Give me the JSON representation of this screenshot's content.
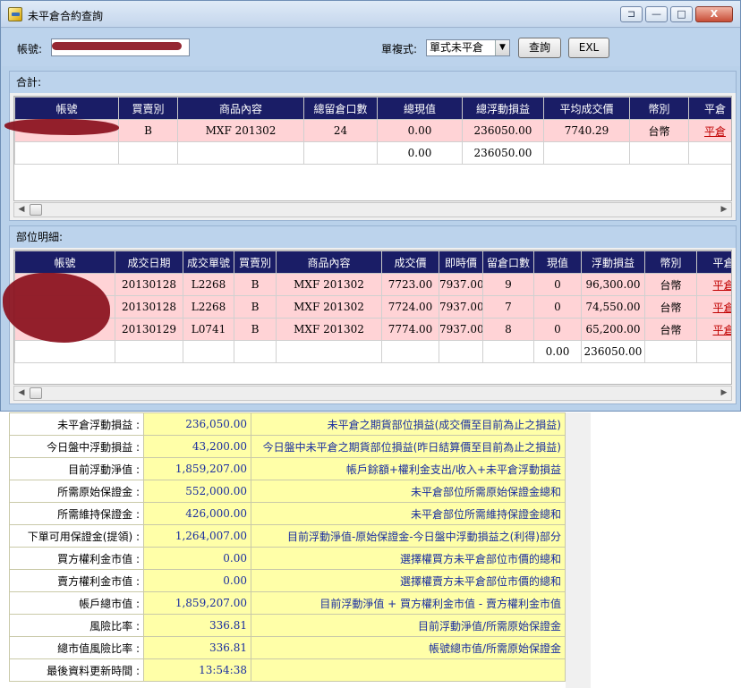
{
  "window": {
    "title": "未平倉合約查詢",
    "buttons": {
      "pin": "⊐",
      "minimize": "—",
      "maximize": "□",
      "close": "X"
    }
  },
  "toolbar": {
    "account_label": "帳號:",
    "mode_label": "單複式:",
    "mode_value": "單式未平倉",
    "query_button": "查詢",
    "exl_button": "EXL"
  },
  "total": {
    "header": "合計:",
    "columns": [
      "帳號",
      "買賣別",
      "商品內容",
      "總留倉口數",
      "總現值",
      "總浮動損益",
      "平均成交價",
      "幣別",
      "平倉"
    ],
    "rows": [
      {
        "account": "",
        "side": "B",
        "product": "MXF 201302",
        "lots": "24",
        "current": "0.00",
        "pnl": "236050.00",
        "avg_price": "7740.29",
        "currency": "台幣",
        "close": "平倉"
      },
      {
        "account": "",
        "side": "",
        "product": "",
        "lots": "",
        "current": "0.00",
        "pnl": "236050.00",
        "avg_price": "",
        "currency": "",
        "close": ""
      }
    ]
  },
  "detail": {
    "header": "部位明細:",
    "columns": [
      "帳號",
      "成交日期",
      "成交單號",
      "買賣別",
      "商品內容",
      "成交價",
      "即時價",
      "留倉口數",
      "現值",
      "浮動損益",
      "幣別",
      "平倉"
    ],
    "rows": [
      {
        "account": "",
        "date": "20130128",
        "order": "L2268",
        "side": "B",
        "product": "MXF 201302",
        "price": "7723.00",
        "live": "7937.00",
        "lots": "9",
        "current": "0",
        "pnl": "96,300.00",
        "currency": "台幣",
        "close": "平倉"
      },
      {
        "account": "",
        "date": "20130128",
        "order": "L2268",
        "side": "B",
        "product": "MXF 201302",
        "price": "7724.00",
        "live": "7937.00",
        "lots": "7",
        "current": "0",
        "pnl": "74,550.00",
        "currency": "台幣",
        "close": "平倉"
      },
      {
        "account": "",
        "date": "20130129",
        "order": "L0741",
        "side": "B",
        "product": "MXF 201302",
        "price": "7774.00",
        "live": "7937.00",
        "lots": "8",
        "current": "0",
        "pnl": "65,200.00",
        "currency": "台幣",
        "close": "平倉"
      },
      {
        "account": "",
        "date": "",
        "order": "",
        "side": "",
        "product": "",
        "price": "",
        "live": "",
        "lots": "",
        "current": "0.00",
        "pnl": "236050.00",
        "currency": "",
        "close": ""
      }
    ]
  },
  "summary": [
    {
      "label": "未平倉浮動損益 :",
      "value": "236,050.00",
      "desc": "未平倉之期貨部位損益(成交價至目前為止之損益)"
    },
    {
      "label": "今日盤中浮動損益 :",
      "value": "43,200.00",
      "desc": "今日盤中未平倉之期貨部位損益(昨日結算價至目前為止之損益)"
    },
    {
      "label": "目前浮動淨值 :",
      "value": "1,859,207.00",
      "desc": "帳戶餘額+權利金支出/收入+未平倉浮動損益"
    },
    {
      "label": "所需原始保證金 :",
      "value": "552,000.00",
      "desc": "未平倉部位所需原始保證金總和"
    },
    {
      "label": "所需維持保證金 :",
      "value": "426,000.00",
      "desc": "未平倉部位所需維持保證金總和"
    },
    {
      "label": "下單可用保證金(提領) :",
      "value": "1,264,007.00",
      "desc": "目前浮動淨值-原始保證金-今日盤中浮動損益之(利得)部分"
    },
    {
      "label": "買方權利金市值 :",
      "value": "0.00",
      "desc": "選擇權買方未平倉部位市價的總和"
    },
    {
      "label": "賣方權利金市值 :",
      "value": "0.00",
      "desc": "選擇權賣方未平倉部位市價的總和"
    },
    {
      "label": "帳戶總市值 :",
      "value": "1,859,207.00",
      "desc": "目前浮動淨值 + 買方權利金市值 - 賣方權利金市值"
    },
    {
      "label": "風險比率 :",
      "value": "336.81",
      "desc": "目前浮動淨值/所需原始保證金"
    },
    {
      "label": "總市值風險比率 :",
      "value": "336.81",
      "desc": "帳號總市值/所需原始保證金"
    },
    {
      "label": "最後資料更新時間 :",
      "value": "13:54:38",
      "desc": ""
    }
  ],
  "colors": {
    "header_bg": "#1a1d66",
    "row_pink": "#ffd3d6",
    "summary_yellow": "#ffffa8",
    "link_red": "#c00000",
    "redaction": "#8a0f1c"
  },
  "icons": [
    "app-icon",
    "pin-icon",
    "minimize-icon",
    "maximize-icon",
    "close-icon",
    "dropdown-arrow-icon",
    "scroll-left-icon",
    "scroll-right-icon"
  ]
}
